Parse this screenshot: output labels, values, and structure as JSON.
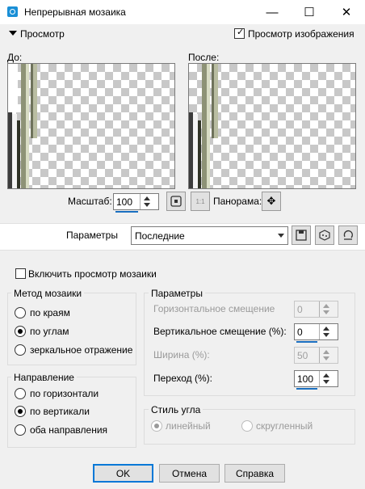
{
  "window": {
    "title": "Непрерывная мозаика",
    "minimize": "—",
    "maximize": "☐",
    "close": "✕",
    "icon": "app-icon"
  },
  "preview_section": {
    "label": "Просмотр",
    "show_preview_label": "Просмотр изображения",
    "show_preview_checked": true
  },
  "before_label": "До:",
  "after_label": "После:",
  "zoom": {
    "label": "Масштаб:",
    "value": "100"
  },
  "pan_label": "Панорама:",
  "one_to_one": "1:1",
  "presets": {
    "label": "Параметры",
    "value": "Последние"
  },
  "tile_preview": {
    "label": "Включить просмотр мозаики",
    "checked": false
  },
  "method": {
    "title": "Метод мозаики",
    "options": [
      "по краям",
      "по углам",
      "зеркальное отражение"
    ],
    "selected": 1
  },
  "direction": {
    "title": "Направление",
    "options": [
      "по горизонтали",
      "по вертикали",
      "оба направления"
    ],
    "selected": 1
  },
  "params": {
    "title": "Параметры",
    "h_offset": {
      "label": "Горизонтальное смещение",
      "value": "0",
      "enabled": false
    },
    "v_offset": {
      "label": "Вертикальное смещение (%):",
      "value": "0",
      "enabled": true
    },
    "width": {
      "label": "Ширина (%):",
      "value": "50",
      "enabled": false
    },
    "transition": {
      "label": "Переход (%):",
      "value": "100",
      "enabled": true
    }
  },
  "corner": {
    "title": "Стиль угла",
    "options": [
      "линейный",
      "скругленный"
    ],
    "selected": 0,
    "enabled": false
  },
  "buttons": {
    "ok": "OK",
    "cancel": "Отмена",
    "help": "Справка"
  }
}
